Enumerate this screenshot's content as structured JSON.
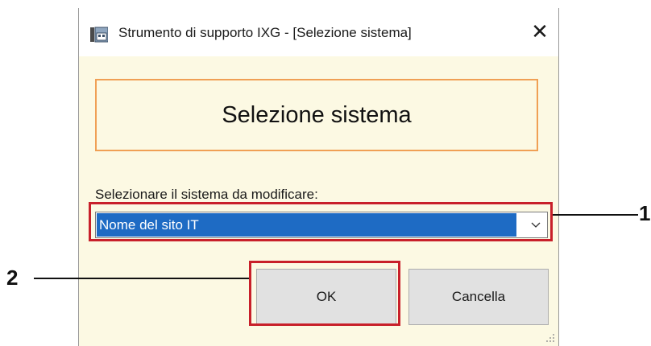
{
  "window": {
    "title": "Strumento di supporto IXG - [Selezione sistema]",
    "close_glyph": "✕"
  },
  "header": {
    "title": "Selezione sistema"
  },
  "form": {
    "select_label": "Selezionare il sistema da modificare:",
    "selected_value": "Nome del sito IT"
  },
  "buttons": {
    "ok_label": "OK",
    "cancel_label": "Cancella"
  },
  "callouts": {
    "one": "1",
    "two": "2"
  },
  "icons": {
    "app": "ixg-support-tool-icon",
    "close": "close-icon",
    "dropdown": "chevron-down-icon",
    "grip": "resize-grip-icon"
  },
  "colors": {
    "dialog_background": "#fcf9e3",
    "header_border": "#f0a055",
    "selection": "#1e6bc4",
    "callout_highlight": "#c8202a"
  }
}
